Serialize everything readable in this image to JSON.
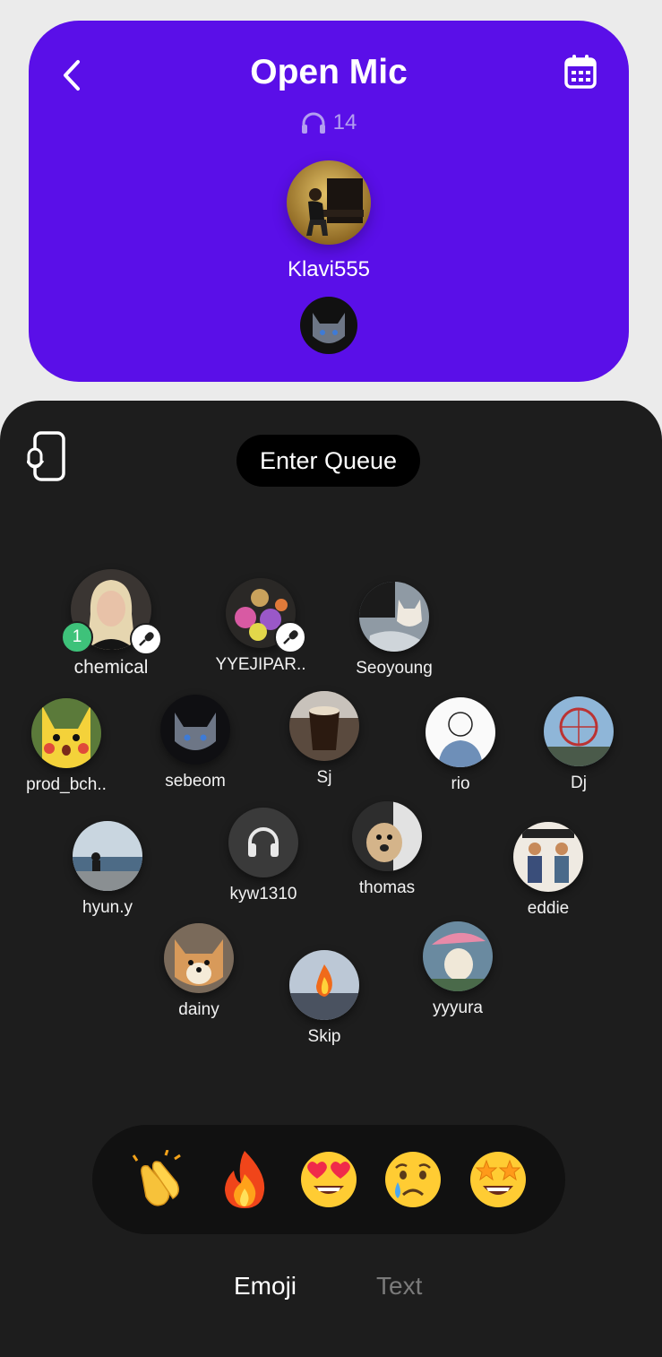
{
  "header": {
    "title": "Open Mic",
    "listener_count": "14",
    "host_name": "Klavi555"
  },
  "controls": {
    "enter_queue_label": "Enter Queue"
  },
  "rank_badge": "1",
  "users": [
    {
      "name": "chemical"
    },
    {
      "name": "YYEJIPAR.."
    },
    {
      "name": "Seoyoung"
    },
    {
      "name": "prod_bch.."
    },
    {
      "name": "sebeom"
    },
    {
      "name": "Sj"
    },
    {
      "name": "rio"
    },
    {
      "name": "Dj"
    },
    {
      "name": "hyun.y"
    },
    {
      "name": "kyw1310"
    },
    {
      "name": "thomas"
    },
    {
      "name": "eddie"
    },
    {
      "name": "dainy"
    },
    {
      "name": "yyyura"
    },
    {
      "name": "Skip"
    }
  ],
  "emojis": [
    "👏",
    "🔥",
    "😍",
    "😢",
    "🤩"
  ],
  "tabs": {
    "emoji": "Emoji",
    "text": "Text"
  },
  "colors": {
    "accent": "#5a0fe8",
    "panel": "#1d1d1d",
    "rank": "#3ec27a"
  }
}
